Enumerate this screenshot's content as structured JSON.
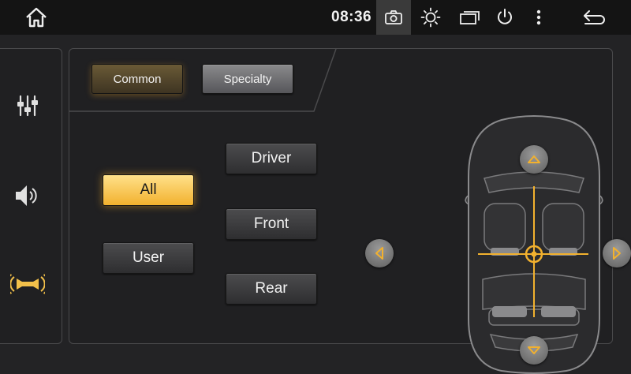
{
  "status_bar": {
    "time": "08:36",
    "icons": [
      "home-icon",
      "camera-icon",
      "brightness-icon",
      "windows-icon",
      "power-icon",
      "more-vert-icon",
      "back-icon"
    ]
  },
  "sidebar": {
    "items": [
      {
        "icon": "equalizer-icon",
        "active": false
      },
      {
        "icon": "volume-icon",
        "active": false
      },
      {
        "icon": "sound-field-icon",
        "active": true
      }
    ]
  },
  "tabs": {
    "common": "Common",
    "specialty": "Specialty",
    "active": "Common"
  },
  "presets": {
    "all": "All",
    "user": "User",
    "driver": "Driver",
    "front": "Front",
    "rear": "Rear",
    "selected": "All"
  },
  "car_controls": [
    "arrow-up-icon",
    "arrow-down-icon",
    "arrow-left-icon",
    "arrow-right-icon"
  ],
  "colors": {
    "accent": "#f2b12e",
    "background": "#232325",
    "status_bar": "#141414"
  }
}
